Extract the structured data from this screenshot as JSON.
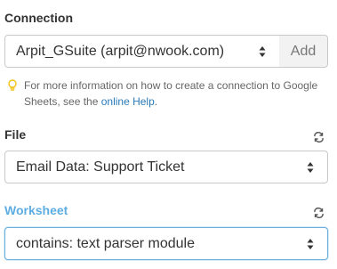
{
  "connection": {
    "label": "Connection",
    "selected": "Arpit_GSuite (arpit@nwook.com)",
    "add_label": "Add",
    "hint_text": "For more information on how to create a connection to Google Sheets, see the ",
    "hint_link": "online Help",
    "hint_suffix": "."
  },
  "file": {
    "label": "File",
    "selected": "Email Data: Support Ticket"
  },
  "worksheet": {
    "label": "Worksheet",
    "selected": "contains: text parser module"
  },
  "colors": {
    "accent": "#5dade2",
    "link": "#2a7ab8",
    "hint_icon": "#f0c419"
  },
  "icons": {
    "select_caret": "sort-caret-icon",
    "refresh": "refresh-icon",
    "hint": "lightbulb-icon"
  }
}
